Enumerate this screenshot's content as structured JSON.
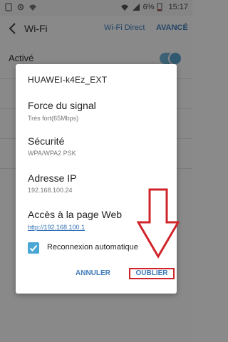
{
  "statusbar": {
    "battery": "6%",
    "time": "15:17"
  },
  "appbar": {
    "title": "Wi-Fi",
    "wifi_direct": "Wi-Fi Direct",
    "advanced": "AVANCÉ"
  },
  "main": {
    "active_label": "Activé",
    "toggle_on": true
  },
  "dialog": {
    "title": "HUAWEI-k4Ez_EXT",
    "signal_label": "Force du signal",
    "signal_value": "Très fort(65Mbps)",
    "security_label": "Sécurité",
    "security_value": "WPA/WPA2 PSK",
    "ip_label": "Adresse IP",
    "ip_value": "192.168.100.24",
    "web_label": "Accès à la page Web",
    "web_link": "http://192.168.100.1",
    "auto_reconnect_label": "Reconnexion automatique",
    "auto_reconnect_checked": true,
    "cancel_button": "ANNULER",
    "forget_button": "OUBLIER"
  },
  "colors": {
    "accent": "#3d7ab8",
    "annotation": "#d0242b",
    "checkbox": "#4aa6d4"
  }
}
